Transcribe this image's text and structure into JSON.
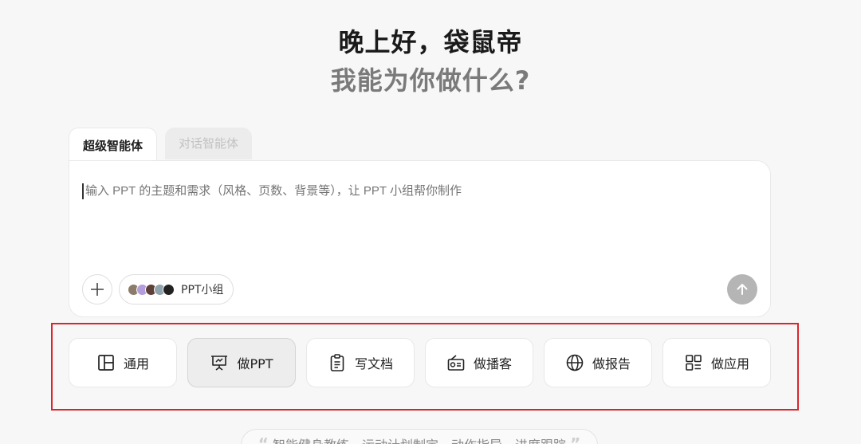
{
  "header": {
    "greeting": "晚上好，袋鼠帝",
    "subtitle": "我能为你做什么?"
  },
  "tabs": [
    {
      "label": "超级智能体",
      "active": true
    },
    {
      "label": "对话智能体",
      "active": false
    }
  ],
  "composer": {
    "placeholder": "输入 PPT 的主题和需求（风格、页数、背景等），让 PPT 小组帮你制作",
    "team_label": "PPT小组",
    "add_icon": "plus-icon",
    "send_icon": "arrow-up-icon"
  },
  "modes": [
    {
      "label": "通用",
      "icon": "layout-icon",
      "selected": false
    },
    {
      "label": "做PPT",
      "icon": "presentation-icon",
      "selected": true
    },
    {
      "label": "写文档",
      "icon": "clipboard-doc-icon",
      "selected": false
    },
    {
      "label": "做播客",
      "icon": "radio-icon",
      "selected": false
    },
    {
      "label": "做报告",
      "icon": "globe-icon",
      "selected": false
    },
    {
      "label": "做应用",
      "icon": "apps-grid-icon",
      "selected": false
    }
  ],
  "suggestion": {
    "text": "智能健身教练、运动计划制定、动作指导、进度跟踪",
    "open_quote": "“",
    "close_quote": "”"
  },
  "colors": {
    "highlight_border": "#d9262c",
    "send_button": "#b5b5b5",
    "selected_mode_bg": "#ededed"
  }
}
